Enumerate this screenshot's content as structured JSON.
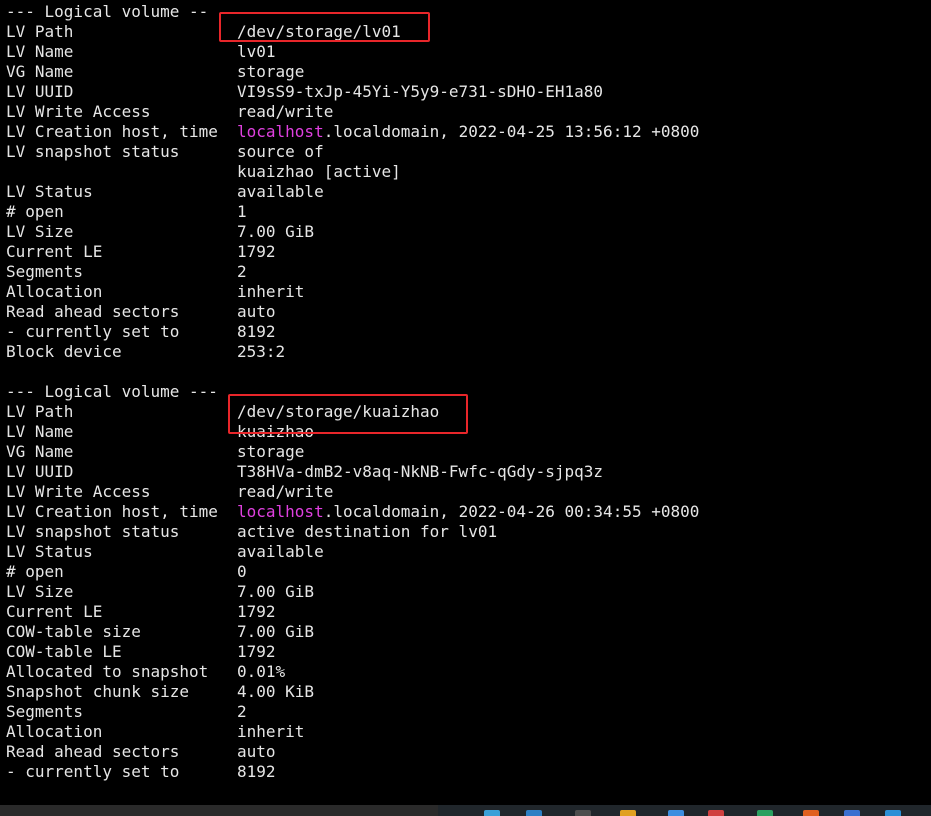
{
  "colors": {
    "background": "#000000",
    "text": "#e6e6e6",
    "hostname": "#e040e0",
    "highlight_box": "#e8262a"
  },
  "volumes": [
    {
      "header": "--- Logical volume ---",
      "header_shown": "--- Logical volume --",
      "rows": [
        {
          "label": "LV Path",
          "value": "/dev/storage/lv01"
        },
        {
          "label": "LV Name",
          "value": "lv01"
        },
        {
          "label": "VG Name",
          "value": "storage"
        },
        {
          "label": "LV UUID",
          "value": "VI9sS9-txJp-45Yi-Y5y9-e731-sDHO-EH1a80"
        },
        {
          "label": "LV Write Access",
          "value": "read/write"
        },
        {
          "label": "LV Creation host, time",
          "host": "localhost",
          "value": ".localdomain, 2022-04-25 13:56:12 +0800"
        },
        {
          "label": "LV snapshot status",
          "value": "source of"
        },
        {
          "label": "",
          "value": "kuaizhao [active]"
        },
        {
          "label": "LV Status",
          "value": "available"
        },
        {
          "label": "# open",
          "value": "1"
        },
        {
          "label": "LV Size",
          "value": "7.00 GiB"
        },
        {
          "label": "Current LE",
          "value": "1792"
        },
        {
          "label": "Segments",
          "value": "2"
        },
        {
          "label": "Allocation",
          "value": "inherit"
        },
        {
          "label": "Read ahead sectors",
          "value": "auto"
        },
        {
          "label": "- currently set to",
          "value": "8192"
        },
        {
          "label": "Block device",
          "value": "253:2"
        }
      ]
    },
    {
      "header": "--- Logical volume ---",
      "rows": [
        {
          "label": "LV Path",
          "value": "/dev/storage/kuaizhao"
        },
        {
          "label": "LV Name",
          "value": "kuaizhao"
        },
        {
          "label": "VG Name",
          "value": "storage"
        },
        {
          "label": "LV UUID",
          "value": "T38HVa-dmB2-v8aq-NkNB-Fwfc-qGdy-sjpq3z"
        },
        {
          "label": "LV Write Access",
          "value": "read/write"
        },
        {
          "label": "LV Creation host, time",
          "host": "localhost",
          "value": ".localdomain, 2022-04-26 00:34:55 +0800"
        },
        {
          "label": "LV snapshot status",
          "value": "active destination for lv01"
        },
        {
          "label": "LV Status",
          "value": "available"
        },
        {
          "label": "# open",
          "value": "0"
        },
        {
          "label": "LV Size",
          "value": "7.00 GiB"
        },
        {
          "label": "Current LE",
          "value": "1792"
        },
        {
          "label": "COW-table size",
          "value": "7.00 GiB"
        },
        {
          "label": "COW-table LE",
          "value": "1792"
        },
        {
          "label": "Allocated to snapshot",
          "value": "0.01%"
        },
        {
          "label": "Snapshot chunk size",
          "value": "4.00 KiB"
        },
        {
          "label": "Segments",
          "value": "2"
        },
        {
          "label": "Allocation",
          "value": "inherit"
        },
        {
          "label": "Read ahead sectors",
          "value": "auto"
        },
        {
          "label": "- currently set to",
          "value": "8192"
        }
      ]
    }
  ]
}
